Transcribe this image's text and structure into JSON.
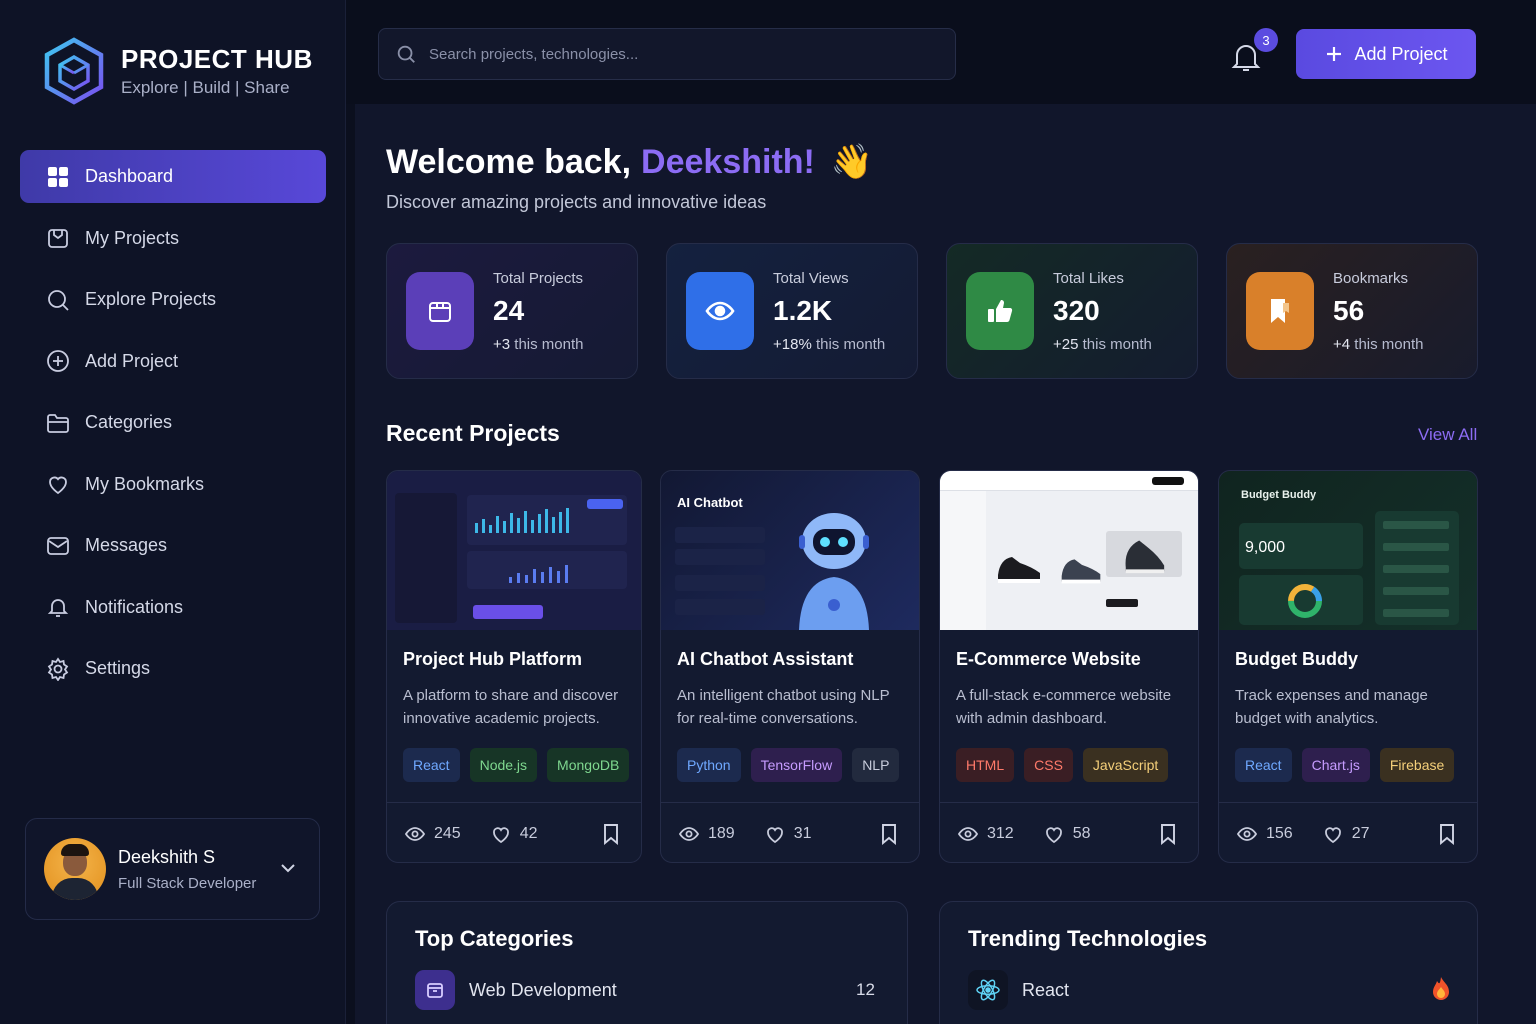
{
  "brand": {
    "title": "PROJECT HUB",
    "subtitle": "Explore | Build | Share"
  },
  "nav": [
    {
      "label": "Dashboard",
      "icon": "grid-icon",
      "active": true
    },
    {
      "label": "My Projects",
      "icon": "box-icon"
    },
    {
      "label": "Explore Projects",
      "icon": "search-icon"
    },
    {
      "label": "Add Project",
      "icon": "plus-circle-icon"
    },
    {
      "label": "Categories",
      "icon": "folder-icon"
    },
    {
      "label": "My Bookmarks",
      "icon": "heart-icon"
    },
    {
      "label": "Messages",
      "icon": "mail-icon"
    },
    {
      "label": "Notifications",
      "icon": "bell-icon"
    },
    {
      "label": "Settings",
      "icon": "gear-icon"
    }
  ],
  "user": {
    "name": "Deekshith S",
    "role": "Full Stack Developer"
  },
  "search": {
    "placeholder": "Search projects, technologies..."
  },
  "notifications": {
    "count": "3"
  },
  "add_project": {
    "label": "Add Project"
  },
  "welcome": {
    "greeting": "Welcome back,",
    "name": "Deekshith!",
    "emoji": "👋",
    "subtitle": "Discover amazing projects and innovative ideas"
  },
  "stats": [
    {
      "label": "Total Projects",
      "value": "24",
      "change": "+3",
      "period": "this month",
      "color": "#5b3fb8"
    },
    {
      "label": "Total Views",
      "value": "1.2K",
      "change": "+18%",
      "period": "this month",
      "color": "#2f6fe8"
    },
    {
      "label": "Total Likes",
      "value": "320",
      "change": "+25",
      "period": "this month",
      "color": "#2f8a45"
    },
    {
      "label": "Bookmarks",
      "value": "56",
      "change": "+4",
      "period": "this month",
      "color": "#d9802a"
    }
  ],
  "recent": {
    "title": "Recent Projects",
    "view_all": "View All"
  },
  "projects": [
    {
      "title": "Project Hub Platform",
      "description": "A platform to share and discover innovative academic projects.",
      "tags": [
        "React",
        "Node.js",
        "MongoDB"
      ],
      "views": "245",
      "likes": "42"
    },
    {
      "title": "AI Chatbot Assistant",
      "description": "An intelligent chatbot using NLP for real-time conversations.",
      "thumb_label": "AI Chatbot",
      "tags": [
        "Python",
        "TensorFlow",
        "NLP"
      ],
      "views": "189",
      "likes": "31"
    },
    {
      "title": "E-Commerce Website",
      "description": "A full-stack e-commerce website with admin dashboard.",
      "tags": [
        "HTML",
        "CSS",
        "JavaScript"
      ],
      "views": "312",
      "likes": "58"
    },
    {
      "title": "Budget Buddy",
      "description": "Track expenses and manage budget with analytics.",
      "thumb_label": "Budget Buddy",
      "thumb_value": "9,000",
      "tags": [
        "React",
        "Chart.js",
        "Firebase"
      ],
      "views": "156",
      "likes": "27"
    }
  ],
  "top_categories": {
    "title": "Top Categories",
    "item": "Web Development",
    "count": "12"
  },
  "trending": {
    "title": "Trending Technologies",
    "item": "React"
  }
}
